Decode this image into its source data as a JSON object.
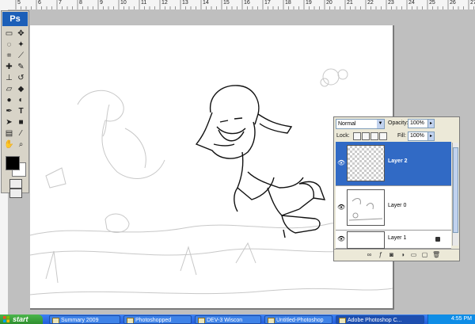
{
  "app": {
    "logo": "Ps"
  },
  "ruler_top": {
    "numbers": [
      "5",
      "6",
      "7",
      "8",
      "9",
      "10",
      "11",
      "12",
      "13",
      "14",
      "15",
      "16",
      "17",
      "18",
      "19",
      "20",
      "21",
      "22",
      "23",
      "24",
      "25",
      "26",
      "27"
    ]
  },
  "toolbox": {
    "tools": [
      "marquee-icon",
      "move-icon",
      "lasso-icon",
      "magic-wand-icon",
      "crop-icon",
      "slice-icon",
      "healing-brush-icon",
      "brush-icon",
      "clone-stamp-icon",
      "history-brush-icon",
      "eraser-icon",
      "paint-bucket-icon",
      "blur-icon",
      "dodge-icon",
      "pen-icon",
      "type-icon",
      "path-selection-icon",
      "shape-icon",
      "notes-icon",
      "eyedropper-icon",
      "hand-icon",
      "zoom-icon"
    ],
    "foreground_color": "#000000",
    "background_color": "#ffffff"
  },
  "layers_panel": {
    "blend_mode": "Normal",
    "opacity_label": "Opacity:",
    "opacity_value": "100%",
    "lock_label": "Lock:",
    "fill_label": "Fill:",
    "fill_value": "100%",
    "layers": [
      {
        "name": "Layer 2",
        "selected": true,
        "locked": false
      },
      {
        "name": "Layer 0",
        "selected": false,
        "locked": false
      },
      {
        "name": "Layer 1",
        "selected": false,
        "locked": true
      }
    ],
    "selection_color": "#316ac5"
  },
  "taskbar": {
    "start_label": "start",
    "tasks": [
      {
        "label": "Summary 2009",
        "active": false
      },
      {
        "label": "Photoshopped",
        "active": false
      },
      {
        "label": "DEV-3 Wiscon",
        "active": false
      },
      {
        "label": "Untitled-Photoshop",
        "active": false
      },
      {
        "label": "Adobe Photoshop C...",
        "active": true
      }
    ],
    "clock": "4:55 PM"
  }
}
